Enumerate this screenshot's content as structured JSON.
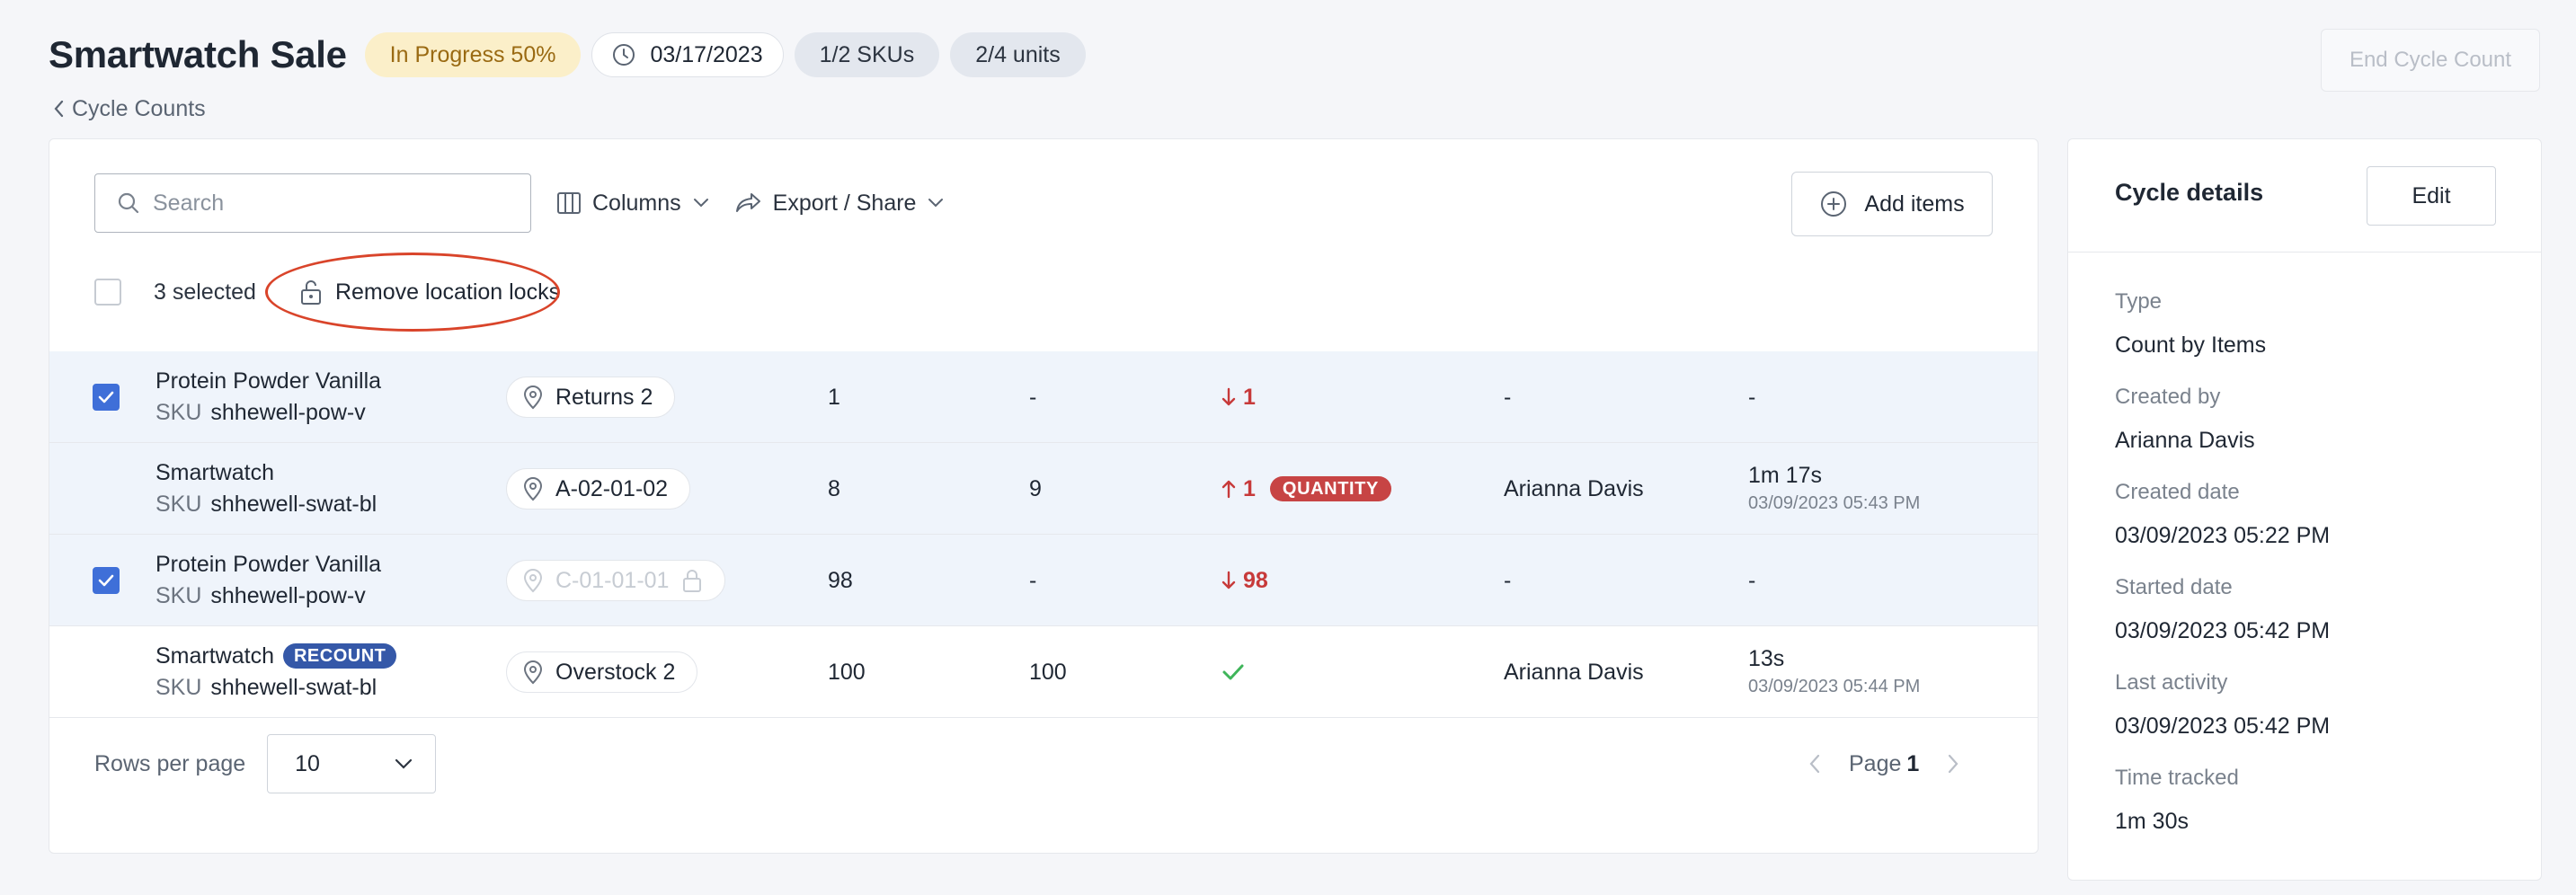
{
  "header": {
    "title": "Smartwatch Sale",
    "progress": "In Progress 50%",
    "date": "03/17/2023",
    "skus": "1/2 SKUs",
    "units": "2/4 units",
    "end_button": "End Cycle Count",
    "breadcrumb": "Cycle Counts"
  },
  "toolbar": {
    "search_placeholder": "Search",
    "columns_label": "Columns",
    "export_label": "Export / Share",
    "add_items_label": "Add items"
  },
  "selection": {
    "count_text": "3 selected",
    "remove_locks_label": "Remove location locks"
  },
  "rows": [
    {
      "name": "Protein Powder Vanilla",
      "sku_label": "SKU",
      "sku": "shhewell-pow-v",
      "badge": "",
      "location": "Returns 2",
      "expected": "1",
      "counted": "-",
      "variance": "1",
      "variance_dir": "down",
      "variance_badge": "",
      "counted_by": "-",
      "time": "-",
      "time_sub": "",
      "checked": true
    },
    {
      "name": "Smartwatch",
      "sku_label": "SKU",
      "sku": "shhewell-swat-bl",
      "badge": "",
      "location": "A-02-01-02",
      "expected": "8",
      "counted": "9",
      "variance": "1",
      "variance_dir": "up",
      "variance_badge": "QUANTITY",
      "counted_by": "Arianna Davis",
      "time": "1m 17s",
      "time_sub": "03/09/2023 05:43 PM",
      "checked": false
    },
    {
      "name": "Protein Powder Vanilla",
      "sku_label": "SKU",
      "sku": "shhewell-pow-v",
      "badge": "",
      "location": "C-01-01-01",
      "expected": "98",
      "counted": "-",
      "variance": "98",
      "variance_dir": "down",
      "variance_badge": "",
      "counted_by": "-",
      "time": "-",
      "time_sub": "",
      "checked": true
    },
    {
      "name": "Smartwatch",
      "sku_label": "SKU",
      "sku": "shhewell-swat-bl",
      "badge": "RECOUNT",
      "location": "Overstock 2",
      "expected": "100",
      "counted": "100",
      "variance": "",
      "variance_dir": "match",
      "variance_badge": "",
      "counted_by": "Arianna Davis",
      "time": "13s",
      "time_sub": "03/09/2023 05:44 PM",
      "checked": false
    }
  ],
  "footer": {
    "rows_per_page_label": "Rows per page",
    "rows_per_page_value": "10",
    "page_label": "Page",
    "page_number": "1"
  },
  "side": {
    "title": "Cycle details",
    "edit_label": "Edit",
    "details": [
      {
        "label": "Type",
        "value": "Count by Items"
      },
      {
        "label": "Created by",
        "value": "Arianna Davis"
      },
      {
        "label": "Created date",
        "value": "03/09/2023 05:22 PM"
      },
      {
        "label": "Started date",
        "value": "03/09/2023 05:42 PM"
      },
      {
        "label": "Last activity",
        "value": "03/09/2023 05:42 PM"
      },
      {
        "label": "Time tracked",
        "value": "1m 30s"
      }
    ]
  },
  "colors": {
    "accent": "#3f6fd8",
    "variance_red": "#c73a3a",
    "match_green": "#3fb55a",
    "annotation": "#d9442a"
  },
  "icons": [
    "clock-icon",
    "chevron-left-icon",
    "search-icon",
    "columns-icon",
    "chevron-down-icon",
    "share-icon",
    "plus-circle-icon",
    "unlock-icon",
    "location-pin-icon",
    "lock-icon",
    "arrow-down-icon",
    "arrow-up-icon",
    "check-icon",
    "chevron-right-icon"
  ]
}
